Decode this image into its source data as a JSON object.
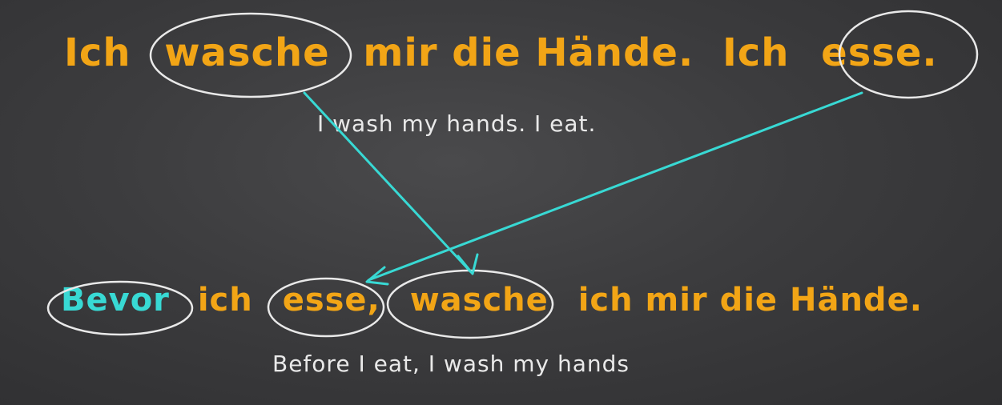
{
  "colors": {
    "chalk_orange": "#f2a516",
    "chalk_white": "#e9e9e9",
    "chalk_cyan": "#38d9d4",
    "board": "#3c3c3e"
  },
  "sentence_de": {
    "w1": "Ich",
    "w2": "wasche",
    "w3": "mir die Hände.",
    "w4": "Ich",
    "w5": "esse."
  },
  "sentence_en": "I wash my hands. I eat.",
  "combined_de": {
    "w1": "Bevor",
    "w2": "ich",
    "w3": "esse,",
    "w4": "wasche",
    "w5": "ich mir die Hände."
  },
  "combined_en": "Before I eat, I wash my hands"
}
